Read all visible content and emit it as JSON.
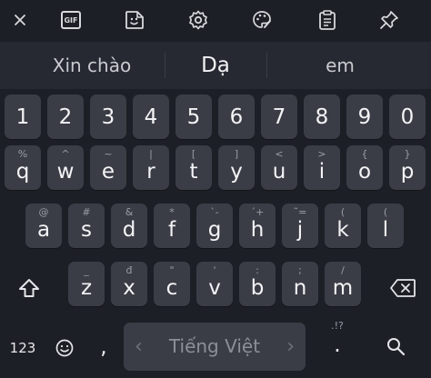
{
  "toolbar": {
    "icons": [
      "close-icon",
      "gif-icon",
      "sticker-icon",
      "settings-icon",
      "theme-palette-icon",
      "clipboard-icon",
      "pin-icon"
    ],
    "gif_label": "GIF"
  },
  "suggestions": [
    "Xin chào",
    "Dạ",
    "em"
  ],
  "rows": {
    "numbers": [
      "1",
      "2",
      "3",
      "4",
      "5",
      "6",
      "7",
      "8",
      "9",
      "0"
    ],
    "row1": {
      "keys": [
        "q",
        "w",
        "e",
        "r",
        "t",
        "y",
        "u",
        "i",
        "o",
        "p"
      ],
      "hints": [
        "%",
        "^",
        "~",
        "|",
        "[",
        "]",
        "<",
        ">",
        "{",
        "}"
      ]
    },
    "row2": {
      "keys": [
        "a",
        "s",
        "d",
        "f",
        "g",
        "h",
        "j",
        "k",
        "l"
      ],
      "hints": [
        "@",
        "#",
        "&",
        "*",
        "`-",
        "´+",
        "˜=",
        "(",
        "("
      ]
    },
    "row3": {
      "keys": [
        "z",
        "x",
        "c",
        "v",
        "b",
        "n",
        "m"
      ],
      "hints": [
        "_",
        "đ",
        "\"",
        "'",
        ":",
        ";",
        "/"
      ]
    }
  },
  "bottom": {
    "mode_label": "123",
    "comma": ",",
    "space_label": "Tiếng Việt",
    "punct_hint": ".!?",
    "period": "."
  },
  "colors": {
    "background": "#1d1f26",
    "key": "#3a3d46",
    "suggestion_bar": "#262931"
  }
}
